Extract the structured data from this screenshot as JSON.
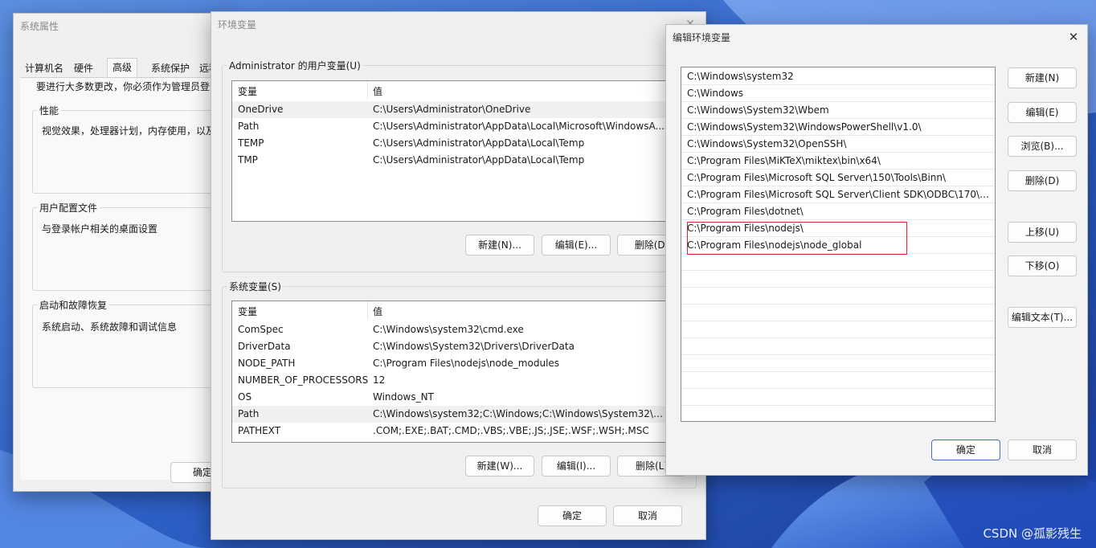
{
  "system_properties": {
    "title": "系统属性",
    "tabs": [
      "计算机名",
      "硬件",
      "高级",
      "系统保护",
      "远程"
    ],
    "active_tab": "高级",
    "admin_note": "要进行大多数更改，你必须作为管理员登录。",
    "groups": [
      {
        "label": "性能",
        "desc": "视觉效果，处理器计划，内存使用，以及虚拟内存"
      },
      {
        "label": "用户配置文件",
        "desc": "与登录帐户相关的桌面设置"
      },
      {
        "label": "启动和故障恢复",
        "desc": "系统启动、系统故障和调试信息"
      }
    ],
    "ok_label": "确定"
  },
  "env_vars": {
    "title": "环境变量",
    "close_icon": "close-icon",
    "user_section": "Administrator 的用户变量(U)",
    "system_section": "系统变量(S)",
    "col_var": "变量",
    "col_val": "值",
    "user_vars": [
      {
        "name": "OneDrive",
        "value": "C:\\Users\\Administrator\\OneDrive"
      },
      {
        "name": "Path",
        "value": "C:\\Users\\Administrator\\AppData\\Local\\Microsoft\\WindowsA..."
      },
      {
        "name": "TEMP",
        "value": "C:\\Users\\Administrator\\AppData\\Local\\Temp"
      },
      {
        "name": "TMP",
        "value": "C:\\Users\\Administrator\\AppData\\Local\\Temp"
      }
    ],
    "system_vars": [
      {
        "name": "ComSpec",
        "value": "C:\\Windows\\system32\\cmd.exe"
      },
      {
        "name": "DriverData",
        "value": "C:\\Windows\\System32\\Drivers\\DriverData"
      },
      {
        "name": "NODE_PATH",
        "value": "C:\\Program Files\\nodejs\\node_modules"
      },
      {
        "name": "NUMBER_OF_PROCESSORS",
        "value": "12"
      },
      {
        "name": "OS",
        "value": "Windows_NT"
      },
      {
        "name": "Path",
        "value": "C:\\Windows\\system32;C:\\Windows;C:\\Windows\\System32\\Wb..."
      },
      {
        "name": "PATHEXT",
        "value": ".COM;.EXE;.BAT;.CMD;.VBS;.VBE;.JS;.JSE;.WSF;.WSH;.MSC"
      }
    ],
    "user_buttons": {
      "new": "新建(N)...",
      "edit": "编辑(E)...",
      "delete": "删除(D)"
    },
    "system_buttons": {
      "new": "新建(W)...",
      "edit": "编辑(I)...",
      "delete": "删除(L)"
    },
    "ok_label": "确定",
    "cancel_label": "取消"
  },
  "edit_env": {
    "title": "编辑环境变量",
    "close_symbol": "✕",
    "entries": [
      "C:\\Windows\\system32",
      "C:\\Windows",
      "C:\\Windows\\System32\\Wbem",
      "C:\\Windows\\System32\\WindowsPowerShell\\v1.0\\",
      "C:\\Windows\\System32\\OpenSSH\\",
      "C:\\Program Files\\MiKTeX\\miktex\\bin\\x64\\",
      "C:\\Program Files\\Microsoft SQL Server\\150\\Tools\\Binn\\",
      "C:\\Program Files\\Microsoft SQL Server\\Client SDK\\ODBC\\170\\T...",
      "C:\\Program Files\\dotnet\\",
      "C:\\Program Files\\nodejs\\",
      "C:\\Program Files\\nodejs\\node_global"
    ],
    "highlight_color": "#e0292f",
    "buttons": {
      "new": "新建(N)",
      "edit": "编辑(E)",
      "browse": "浏览(B)...",
      "delete": "删除(D)",
      "move_up": "上移(U)",
      "move_down": "下移(O)",
      "edit_text": "编辑文本(T)..."
    },
    "ok_label": "确定",
    "cancel_label": "取消"
  },
  "watermark": "CSDN @孤影残生"
}
